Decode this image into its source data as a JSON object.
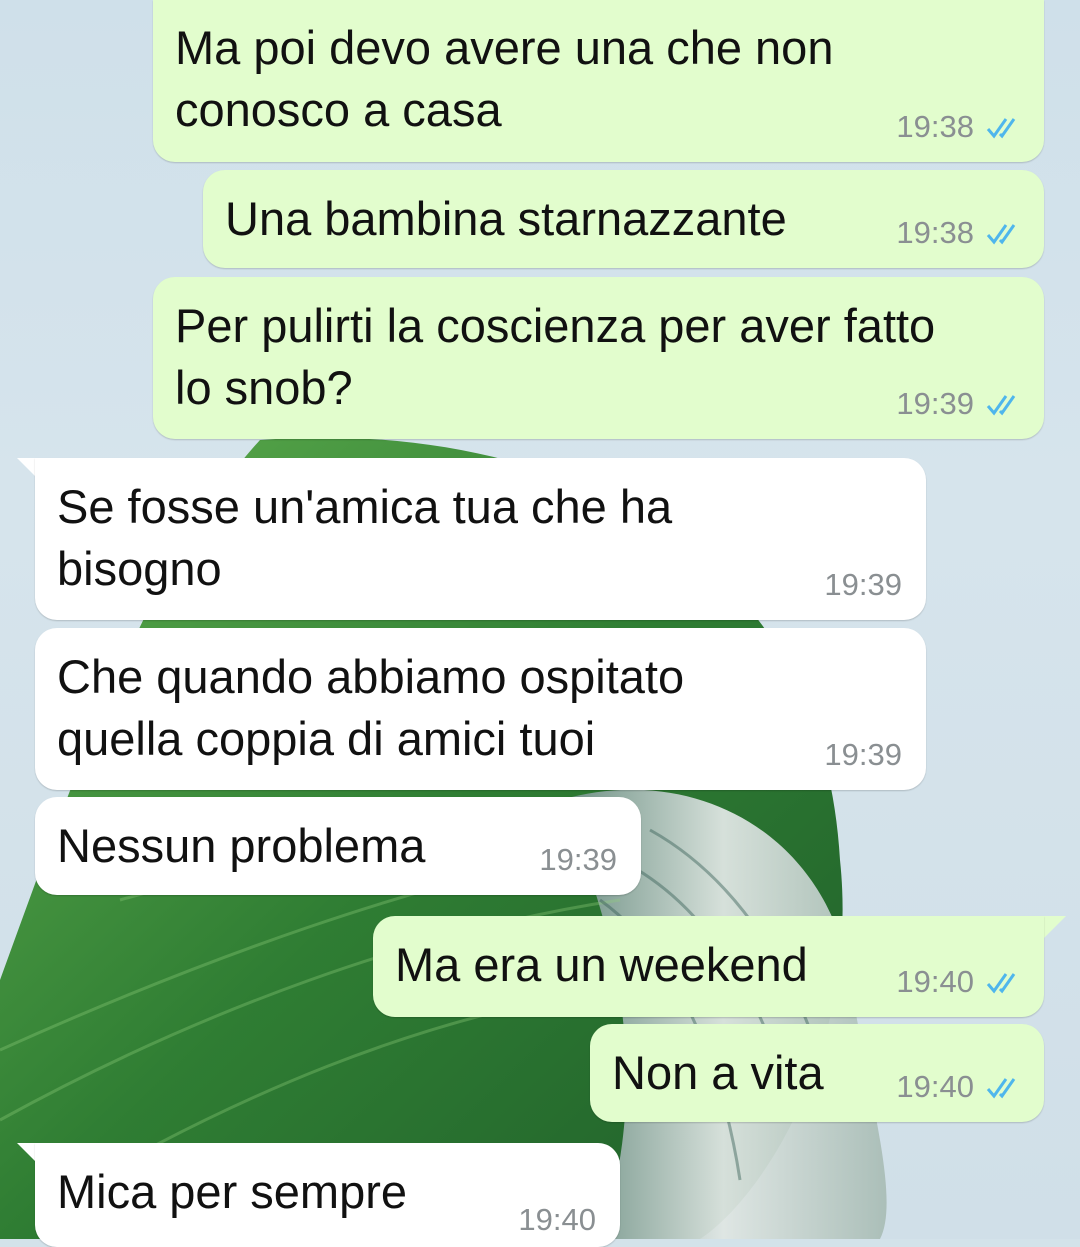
{
  "messages": [
    {
      "direction": "outgoing",
      "text_lines": [
        "Ma poi devo avere una che non",
        "conosco a casa"
      ],
      "time": "19:38",
      "status_icon": "double-check-read-icon"
    },
    {
      "direction": "outgoing",
      "text_lines": [
        "Una bambina starnazzante"
      ],
      "time": "19:38",
      "status_icon": "double-check-read-icon"
    },
    {
      "direction": "outgoing",
      "text_lines": [
        "Per pulirti la coscienza per aver fatto",
        "lo snob?"
      ],
      "time": "19:39",
      "status_icon": "double-check-read-icon"
    },
    {
      "direction": "incoming",
      "text_lines": [
        "Se fosse un'amica tua che ha",
        "bisogno"
      ],
      "time": "19:39"
    },
    {
      "direction": "incoming",
      "text_lines": [
        "Che quando abbiamo ospitato",
        "quella coppia di amici tuoi"
      ],
      "time": "19:39"
    },
    {
      "direction": "incoming",
      "text_lines": [
        "Nessun problema"
      ],
      "time": "19:39"
    },
    {
      "direction": "outgoing",
      "text_lines": [
        "Ma era un weekend"
      ],
      "time": "19:40",
      "status_icon": "double-check-read-icon"
    },
    {
      "direction": "outgoing",
      "text_lines": [
        "Non a vita"
      ],
      "time": "19:40",
      "status_icon": "double-check-read-icon"
    },
    {
      "direction": "incoming",
      "text_lines": [
        "Mica per sempre"
      ],
      "time": "19:40"
    }
  ],
  "colors": {
    "outgoing_bubble": "#e2fdcd",
    "incoming_bubble": "#ffffff",
    "read_ticks": "#4fb6ec",
    "timestamp": "#8a8f92",
    "wallpaper_leaf": "#3f8a3a"
  }
}
